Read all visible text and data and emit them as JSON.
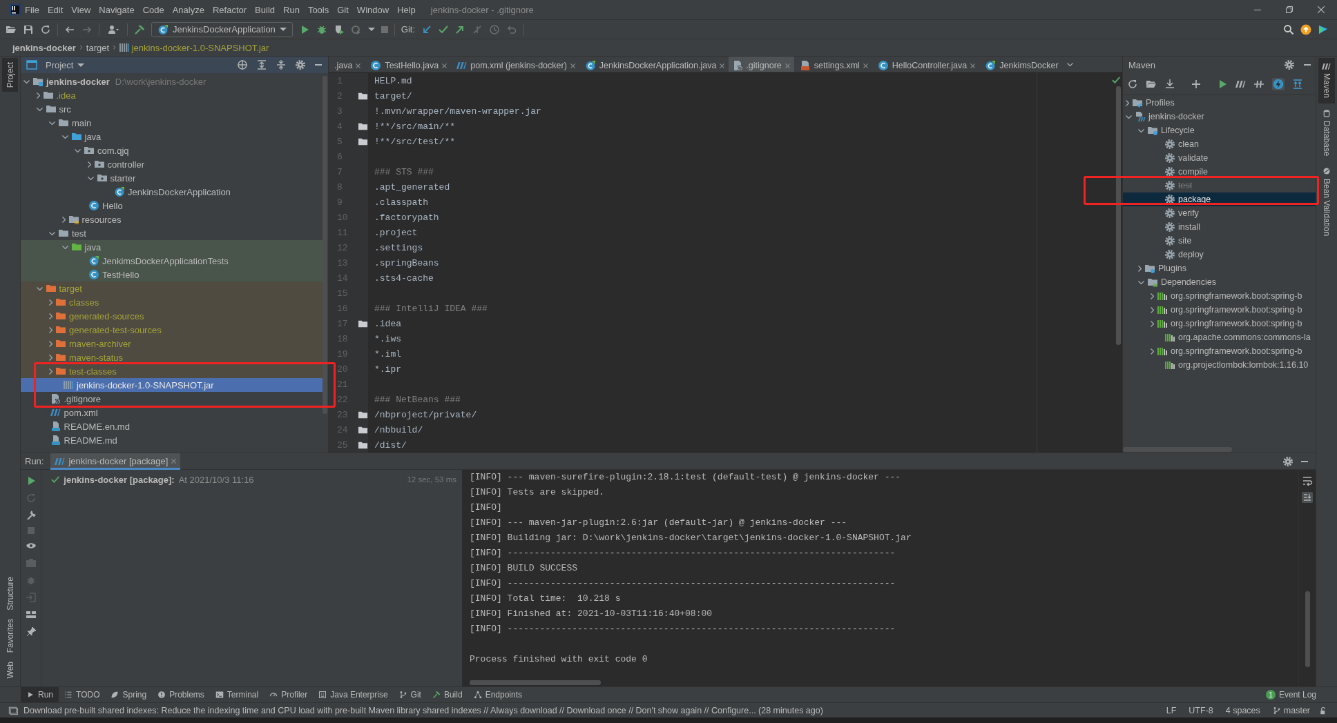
{
  "window": {
    "title": "jenkins-docker - .gitignore"
  },
  "menu": [
    "File",
    "Edit",
    "View",
    "Navigate",
    "Code",
    "Analyze",
    "Refactor",
    "Build",
    "Run",
    "Tools",
    "Git",
    "Window",
    "Help"
  ],
  "toolbar": {
    "run_config": "JenkinsDockerApplication",
    "git_label": "Git:"
  },
  "breadcrumb": [
    {
      "text": "jenkins-docker",
      "kind": "module"
    },
    {
      "text": "target",
      "kind": "folder"
    },
    {
      "text": "jenkins-docker-1.0-SNAPSHOT.jar",
      "kind": "jar"
    }
  ],
  "left_stripe": {
    "top": [
      {
        "label": "Project",
        "selected": true
      }
    ],
    "bottom": [
      {
        "label": "Structure",
        "selected": false
      },
      {
        "label": "Favorites",
        "selected": false
      },
      {
        "label": "Web",
        "selected": false
      }
    ]
  },
  "project": {
    "title": "Project",
    "tree": [
      {
        "name": "jenkins-docker",
        "kind": "module",
        "note": "D:\\work\\jenkins-docker",
        "expanded": true,
        "selected": false,
        "ignored": false,
        "children": [
          {
            "name": ".idea",
            "kind": "folder",
            "expanded": false,
            "selected": false,
            "ignored": true
          },
          {
            "name": "src",
            "kind": "folder",
            "expanded": true,
            "selected": false,
            "ignored": false,
            "children": [
              {
                "name": "main",
                "kind": "folder",
                "expanded": true,
                "selected": false,
                "ignored": false,
                "children": [
                  {
                    "name": "java",
                    "kind": "source-folder",
                    "expanded": true,
                    "selected": false,
                    "ignored": false,
                    "children": [
                      {
                        "name": "com.qjq",
                        "kind": "package",
                        "expanded": true,
                        "selected": false,
                        "ignored": false,
                        "children": [
                          {
                            "name": "controller",
                            "kind": "package",
                            "expanded": false,
                            "selected": false,
                            "ignored": false
                          },
                          {
                            "name": "starter",
                            "kind": "package",
                            "expanded": true,
                            "selected": false,
                            "ignored": false,
                            "children": [
                              {
                                "name": "JenkinsDockerApplication",
                                "kind": "spring-class",
                                "selected": false,
                                "ignored": false
                              }
                            ]
                          }
                        ]
                      },
                      {
                        "name": "Hello",
                        "kind": "class",
                        "selected": false,
                        "ignored": false
                      }
                    ]
                  },
                  {
                    "name": "resources",
                    "kind": "resources",
                    "expanded": false,
                    "selected": false,
                    "ignored": false
                  }
                ]
              },
              {
                "name": "test",
                "kind": "folder",
                "expanded": true,
                "selected": false,
                "ignored": false,
                "children": [
                  {
                    "name": "java",
                    "kind": "test-folder",
                    "test_scope": true,
                    "expanded": true,
                    "selected": false,
                    "ignored": false,
                    "children": [
                      {
                        "name": "JenkimsDockerApplicationTests",
                        "kind": "spring-class",
                        "selected": false,
                        "ignored": false
                      },
                      {
                        "name": "TestHello",
                        "kind": "class",
                        "selected": false,
                        "ignored": false
                      }
                    ]
                  }
                ]
              }
            ]
          },
          {
            "name": "target",
            "kind": "excluded-folder",
            "excluded": true,
            "expanded": true,
            "selected": false,
            "ignored": true,
            "children": [
              {
                "name": "classes",
                "kind": "excluded-folder",
                "expanded": false,
                "selected": false,
                "ignored": true
              },
              {
                "name": "generated-sources",
                "kind": "excluded-folder",
                "expanded": false,
                "selected": false,
                "ignored": true
              },
              {
                "name": "generated-test-sources",
                "kind": "excluded-folder",
                "expanded": false,
                "selected": false,
                "ignored": true
              },
              {
                "name": "maven-archiver",
                "kind": "excluded-folder",
                "expanded": false,
                "selected": false,
                "ignored": true
              },
              {
                "name": "maven-status",
                "kind": "excluded-folder",
                "expanded": false,
                "selected": false,
                "ignored": true
              },
              {
                "name": "test-classes",
                "kind": "excluded-folder",
                "expanded": false,
                "selected": false,
                "ignored": true
              },
              {
                "name": "jenkins-docker-1.0-SNAPSHOT.jar",
                "kind": "jar",
                "selected": true,
                "ignored": true
              }
            ]
          },
          {
            "name": ".gitignore",
            "kind": "gitignore",
            "selected": false,
            "ignored": false
          },
          {
            "name": "pom.xml",
            "kind": "maven-pom",
            "selected": false,
            "ignored": false
          },
          {
            "name": "README.en.md",
            "kind": "markdown",
            "selected": false,
            "ignored": false
          },
          {
            "name": "README.md",
            "kind": "markdown",
            "selected": false,
            "ignored": false
          }
        ]
      }
    ]
  },
  "editor": {
    "tabs": [
      {
        "label": ".java",
        "selected": false
      },
      {
        "label": "TestHello.java",
        "kind": "class",
        "selected": false
      },
      {
        "label": "pom.xml (jenkins-docker)",
        "kind": "maven-pom",
        "selected": false
      },
      {
        "label": "JenkinsDockerApplication.java",
        "kind": "spring-class",
        "selected": false
      },
      {
        "label": ".gitignore",
        "kind": "gitignore",
        "selected": true
      },
      {
        "label": "settings.xml",
        "kind": "xml",
        "selected": false
      },
      {
        "label": "HelloController.java",
        "kind": "class",
        "selected": false
      },
      {
        "label": "JenkimsDocker",
        "kind": "spring-class",
        "selected": false
      }
    ],
    "lines": [
      {
        "number": "1",
        "text": "HELP.md",
        "kind": "plain",
        "folder_mark": false
      },
      {
        "number": "2",
        "text": "target/",
        "kind": "plain",
        "folder_mark": true
      },
      {
        "number": "3",
        "text": "!.mvn/wrapper/maven-wrapper.jar",
        "kind": "plain",
        "folder_mark": false
      },
      {
        "number": "4",
        "text": "!**/src/main/**",
        "kind": "plain",
        "folder_mark": true
      },
      {
        "number": "5",
        "text": "!**/src/test/**",
        "kind": "plain",
        "folder_mark": true
      },
      {
        "number": "6"
      },
      {
        "number": "7",
        "text": "### STS ###",
        "kind": "comment",
        "folder_mark": false
      },
      {
        "number": "8",
        "text": ".apt_generated",
        "kind": "plain",
        "folder_mark": false
      },
      {
        "number": "9",
        "text": ".classpath",
        "kind": "plain",
        "folder_mark": false
      },
      {
        "number": "10",
        "text": ".factorypath",
        "kind": "plain",
        "folder_mark": false
      },
      {
        "number": "11",
        "text": ".project",
        "kind": "plain",
        "folder_mark": false
      },
      {
        "number": "12",
        "text": ".settings",
        "kind": "plain",
        "folder_mark": false
      },
      {
        "number": "13",
        "text": ".springBeans",
        "kind": "plain",
        "folder_mark": false
      },
      {
        "number": "14",
        "text": ".sts4-cache",
        "kind": "plain",
        "folder_mark": false
      },
      {
        "number": "15"
      },
      {
        "number": "16",
        "text": "### IntelliJ IDEA ###",
        "kind": "comment",
        "folder_mark": false
      },
      {
        "number": "17",
        "text": ".idea",
        "kind": "plain",
        "folder_mark": true
      },
      {
        "number": "18",
        "text": "*.iws",
        "kind": "plain",
        "folder_mark": false
      },
      {
        "number": "19",
        "text": "*.iml",
        "kind": "plain",
        "folder_mark": false
      },
      {
        "number": "20",
        "text": "*.ipr",
        "kind": "plain",
        "folder_mark": false
      },
      {
        "number": "21"
      },
      {
        "number": "22",
        "text": "### NetBeans ###",
        "kind": "comment",
        "folder_mark": false
      },
      {
        "number": "23",
        "text": "/nbproject/private/",
        "kind": "plain",
        "folder_mark": true
      },
      {
        "number": "24",
        "text": "/nbbuild/",
        "kind": "plain",
        "folder_mark": true
      },
      {
        "number": "25",
        "text": "/dist/",
        "kind": "plain",
        "folder_mark": true
      }
    ]
  },
  "maven": {
    "title": "Maven",
    "tree": [
      {
        "name": "Profiles",
        "kind": "profiles",
        "expanded": false,
        "selected": false
      },
      {
        "name": "jenkins-docker",
        "kind": "maven-module",
        "expanded": true,
        "selected": false,
        "children": [
          {
            "name": "Lifecycle",
            "kind": "lifecycle-folder",
            "expanded": true,
            "selected": false,
            "children": [
              {
                "name": "clean",
                "kind": "goal",
                "selected": false,
                "skipped": false
              },
              {
                "name": "validate",
                "kind": "goal",
                "selected": false,
                "skipped": false
              },
              {
                "name": "compile",
                "kind": "goal",
                "selected": false,
                "skipped": false
              },
              {
                "name": "test",
                "kind": "goal",
                "selected": false,
                "skipped": true
              },
              {
                "name": "package",
                "kind": "goal",
                "selected": true,
                "skipped": false
              },
              {
                "name": "verify",
                "kind": "goal",
                "selected": false,
                "skipped": false
              },
              {
                "name": "install",
                "kind": "goal",
                "selected": false,
                "skipped": false
              },
              {
                "name": "site",
                "kind": "goal",
                "selected": false,
                "skipped": false
              },
              {
                "name": "deploy",
                "kind": "goal",
                "selected": false,
                "skipped": false
              }
            ]
          },
          {
            "name": "Plugins",
            "kind": "lifecycle-folder",
            "expanded": false,
            "selected": false
          },
          {
            "name": "Dependencies",
            "kind": "dependencies-folder",
            "expanded": true,
            "selected": false,
            "children": [
              {
                "name": "org.springframework.boot:spring-b",
                "kind": "library",
                "expanded": false,
                "selected": false
              },
              {
                "name": "org.springframework.boot:spring-b",
                "kind": "library",
                "expanded": false,
                "selected": false
              },
              {
                "name": "org.springframework.boot:spring-b",
                "kind": "library",
                "expanded": false,
                "selected": false
              },
              {
                "name": "org.apache.commons:commons-la",
                "kind": "library",
                "selected": false
              },
              {
                "name": "org.springframework.boot:spring-b",
                "kind": "library",
                "expanded": false,
                "selected": false
              },
              {
                "name": "org.projectlombok:lombok:1.16.10",
                "kind": "library",
                "selected": false
              }
            ]
          }
        ]
      }
    ]
  },
  "right_stripe": [
    {
      "label": "Maven",
      "selected": true
    },
    {
      "label": "Database",
      "selected": false
    },
    {
      "label": "Bean Validation",
      "selected": false
    }
  ],
  "run": {
    "label": "Run:",
    "tab": "jenkins-docker [package]",
    "task": {
      "name": "jenkins-docker [package]:",
      "time": "At 2021/10/3 11:16",
      "duration": "12 sec, 53 ms",
      "succeeded": true
    },
    "console": [
      {
        "kind": "log",
        "text": "[INFO] --- maven-surefire-plugin:2.18.1:test (default-test) @ jenkins-docker ---"
      },
      {
        "kind": "log",
        "text": "[INFO] Tests are skipped."
      },
      {
        "kind": "log",
        "text": "[INFO]"
      },
      {
        "kind": "log",
        "text": "[INFO] --- maven-jar-plugin:2.6:jar (default-jar) @ jenkins-docker ---"
      },
      {
        "kind": "log",
        "text": "[INFO] Building jar: D:\\work\\jenkins-docker\\target\\jenkins-docker-1.0-SNAPSHOT.jar"
      },
      {
        "kind": "log",
        "text": "[INFO] ------------------------------------------------------------------------"
      },
      {
        "kind": "log",
        "text": "[INFO] BUILD SUCCESS"
      },
      {
        "kind": "log",
        "text": "[INFO] ------------------------------------------------------------------------"
      },
      {
        "kind": "log",
        "text": "[INFO] Total time:  10.218 s"
      },
      {
        "kind": "log",
        "text": "[INFO] Finished at: 2021-10-03T11:16:40+08:00"
      },
      {
        "kind": "log",
        "text": "[INFO] ------------------------------------------------------------------------"
      },
      {
        "kind": "blank"
      },
      {
        "kind": "log",
        "text": "Process finished with exit code 0"
      }
    ]
  },
  "tool_windows": [
    {
      "label": "Run",
      "selected": true
    },
    {
      "label": "TODO",
      "selected": false
    },
    {
      "label": "Spring",
      "selected": false
    },
    {
      "label": "Problems",
      "selected": false
    },
    {
      "label": "Terminal",
      "selected": false
    },
    {
      "label": "Profiler",
      "selected": false
    },
    {
      "label": "Java Enterprise",
      "selected": false
    },
    {
      "label": "Git",
      "selected": false
    },
    {
      "label": "Build",
      "selected": false
    },
    {
      "label": "Endpoints",
      "selected": false
    }
  ],
  "event_log": {
    "count": "1",
    "label": "Event Log"
  },
  "status": {
    "message": "Download pre-built shared indexes: Reduce the indexing time and CPU load with pre-built Maven library shared indexes // Always download // Download once // Don't show again // Configure... (28 minutes ago)",
    "items": [
      "LF",
      "UTF-8",
      "4 spaces",
      "master"
    ]
  }
}
